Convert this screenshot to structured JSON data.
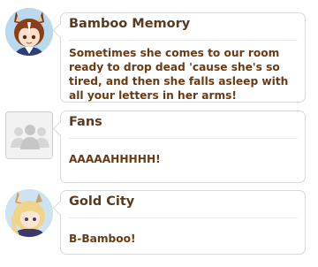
{
  "messages": [
    {
      "sender": "Bamboo Memory",
      "text": "Sometimes she comes to our room ready to drop dead 'cause she's so tired, and then she falls asleep with all your letters in her arms!",
      "avatar_icon": "character-avatar-icon"
    },
    {
      "sender": "Fans",
      "text": "AAAAAHHHHH!",
      "avatar_icon": "group-silhouette-icon"
    },
    {
      "sender": "Gold City",
      "text": "B-Bamboo!",
      "avatar_icon": "character-avatar-icon"
    }
  ],
  "colors": {
    "name": "#5a3a1e",
    "text": "#6b3a12",
    "bubble_border": "#d9d9d9"
  }
}
